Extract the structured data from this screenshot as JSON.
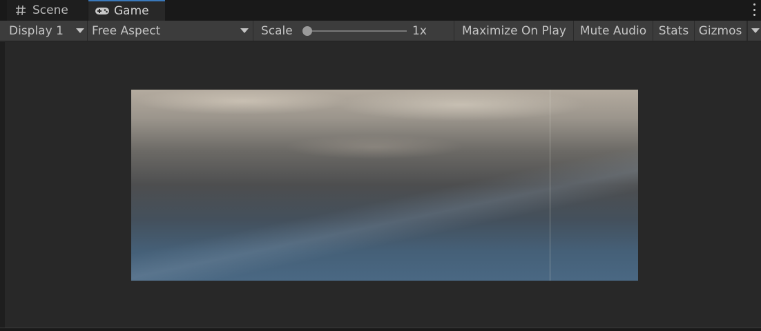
{
  "tabs": [
    {
      "label": "Scene",
      "icon": "grid-hash-icon"
    },
    {
      "label": "Game",
      "icon": "gamepad-icon",
      "active": true
    }
  ],
  "toolbar": {
    "display_label": "Display 1",
    "aspect_label": "Free Aspect",
    "scale_label": "Scale",
    "scale_value": "1x",
    "maximize_label": "Maximize On Play",
    "mute_label": "Mute Audio",
    "stats_label": "Stats",
    "gizmos_label": "Gizmos"
  },
  "colors": {
    "active_tab_accent": "#3a79bb",
    "toolbar_bg": "#3c3c3c",
    "panel_bg": "#282828"
  }
}
